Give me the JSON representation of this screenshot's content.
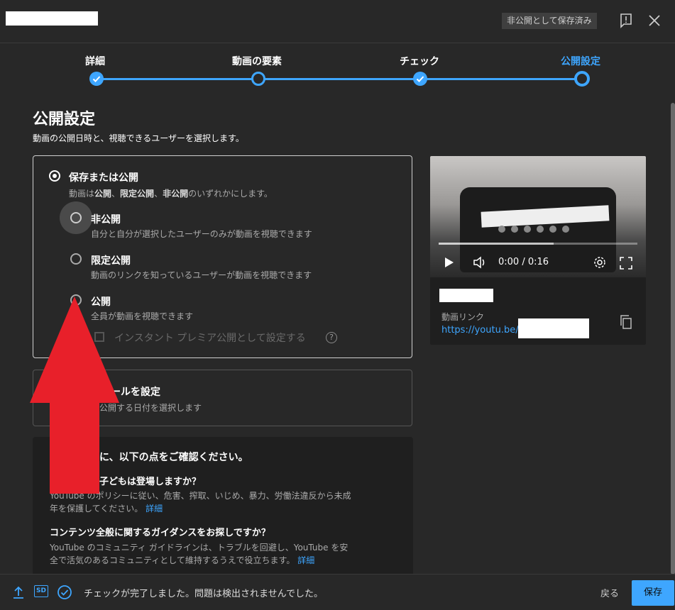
{
  "header": {
    "saved_badge": "非公開として保存済み",
    "feedback_icon": "feedback-icon",
    "close_icon": "close-icon"
  },
  "stepper": {
    "steps": [
      {
        "label": "詳細"
      },
      {
        "label": "動画の要素"
      },
      {
        "label": "チェック"
      },
      {
        "label": "公開設定"
      }
    ],
    "active_color": "#3ea6ff"
  },
  "main": {
    "title": "公開設定",
    "subtitle": "動画の公開日時と、視聴できるユーザーを選択します。",
    "save_or_publish": {
      "title": "保存または公開",
      "desc_parts": [
        "動画は",
        "公開",
        "、",
        "限定公開",
        "、",
        "非公開",
        "のいずれかにします。"
      ],
      "options": [
        {
          "title": "非公開",
          "desc": "自分と自分が選択したユーザーのみが動画を視聴できます"
        },
        {
          "title": "限定公開",
          "desc": "動画のリンクを知っているユーザーが動画を視聴できます"
        },
        {
          "title": "公開",
          "desc": "全員が動画を視聴できます"
        }
      ],
      "premiere_label": "インスタント プレミア公開として設定する",
      "help_glyph": "?"
    },
    "schedule": {
      "title_visible": "ールを設定",
      "desc_visible": "公開する日付を選択します"
    },
    "info": {
      "heading": "公開する前に、以下の点をご確認ください。",
      "q1_visible": "子どもは登場しますか？",
      "q1_text": "YouTube のポリシーに従い、危害、搾取、いじめ、暴力、労働法違反から未成年を保護してください。",
      "q1_link": "詳細",
      "q2": "コンテンツ全般に関するガイダンスをお探しですか？",
      "q2_text": "YouTube のコミュニティ ガイドラインは、トラブルを回避し、YouTube を安全で活気のあるコミュニティとして維持するうえで役立ちます。",
      "q2_link": "詳細"
    }
  },
  "preview": {
    "time": "0:00 / 0:16",
    "link_label": "動画リンク",
    "link_text": "https://youtu.be/"
  },
  "footer": {
    "status": "チェックが完了しました。問題は検出されませんでした。",
    "sd_label": "SD",
    "back": "戻る",
    "save": "保存"
  }
}
